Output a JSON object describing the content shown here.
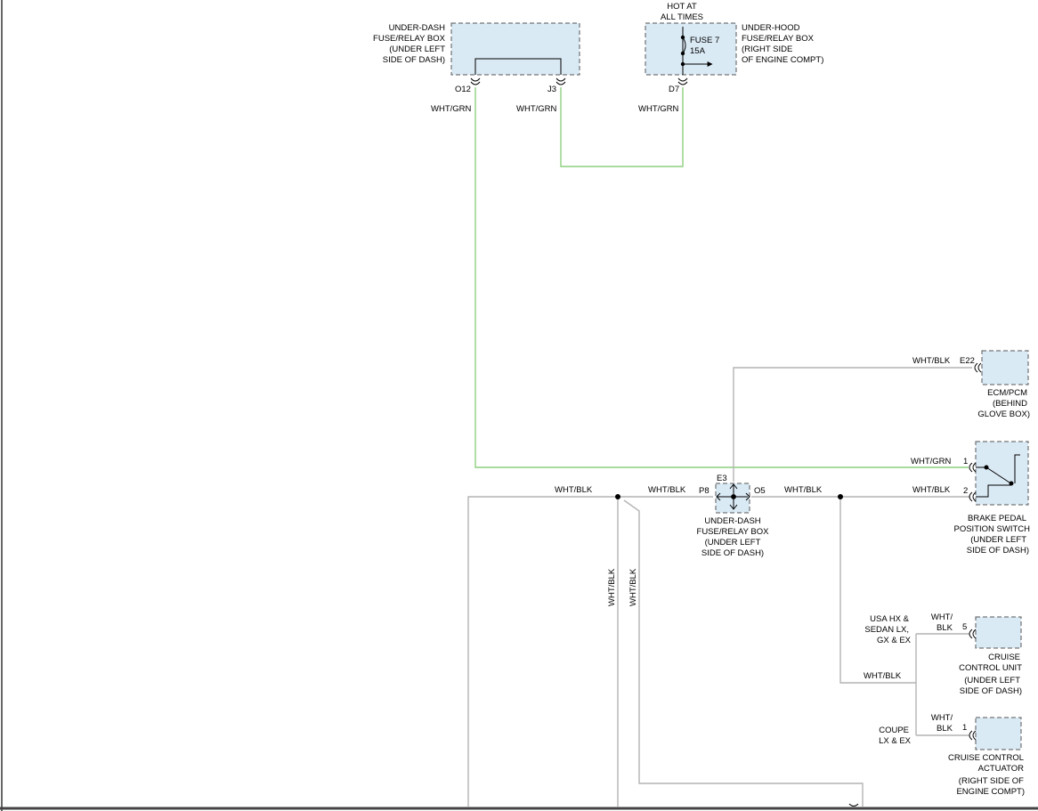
{
  "components": {
    "underdash_top": {
      "lines": [
        "UNDER-DASH",
        "FUSE/RELAY BOX",
        "(UNDER LEFT",
        "SIDE OF DASH)"
      ]
    },
    "underhood": {
      "lines": [
        "UNDER-HOOD",
        "FUSE/RELAY BOX",
        "(RIGHT SIDE",
        "OF ENGINE COMPT)"
      ]
    },
    "hot_at_all_times": {
      "lines": [
        "HOT AT",
        "ALL TIMES"
      ]
    },
    "fuse": {
      "name": "FUSE 7",
      "rating": "15A"
    },
    "ecm": {
      "lines": [
        "ECM/PCM",
        "(BEHIND",
        "GLOVE BOX)"
      ]
    },
    "brake_switch": {
      "lines": [
        "BRAKE PEDAL",
        "POSITION SWITCH",
        "(UNDER LEFT",
        "SIDE OF DASH)"
      ]
    },
    "underdash_mid": {
      "lines": [
        "UNDER-DASH",
        "FUSE/RELAY BOX",
        "(UNDER LEFT",
        "SIDE OF DASH)"
      ]
    },
    "cruise_unit": {
      "lines": [
        "CRUISE",
        "CONTROL UNIT",
        "(UNDER LEFT",
        "SIDE OF DASH)"
      ]
    },
    "cruise_actuator": {
      "lines": [
        "CRUISE CONTROL",
        "ACTUATOR",
        "(RIGHT SIDE OF",
        "ENGINE COMPT)"
      ]
    }
  },
  "pins": {
    "o12": "O12",
    "j3": "J3",
    "d7": "D7",
    "e22": "E22",
    "brake_1": "1",
    "brake_2": "2",
    "e3": "E3",
    "p8": "P8",
    "o5": "O5",
    "cruise_unit_5": "5",
    "cruise_act_1": "1"
  },
  "wire_labels": {
    "wht_grn_o12": "WHT/GRN",
    "wht_grn_j3": "WHT/GRN",
    "wht_grn_d7": "WHT/GRN",
    "wht_blk_e22": "WHT/BLK",
    "wht_grn_brake": "WHT/GRN",
    "wht_blk_brake": "WHT/BLK",
    "wht_blk_left": "WHT/BLK",
    "wht_blk_p8": "WHT/BLK",
    "wht_blk_o5": "WHT/BLK",
    "wht_blk_vert1": "WHT/BLK",
    "wht_blk_vert2": "WHT/BLK",
    "wht_blk_branch": "WHT/BLK",
    "wht_blk_cruise_unit": [
      "WHT/",
      "BLK"
    ],
    "wht_blk_cruise_act": [
      "WHT/",
      "BLK"
    ]
  },
  "variants": {
    "usa": [
      "USA HX &",
      "SEDAN LX,",
      "GX & EX"
    ],
    "coupe": [
      "COUPE",
      "LX & EX"
    ]
  },
  "colors": {
    "wire_green": "#8ecf7f",
    "wire_gray": "#b4b4b4",
    "box_fill": "#daeaf5",
    "box_dash": "#555555"
  }
}
